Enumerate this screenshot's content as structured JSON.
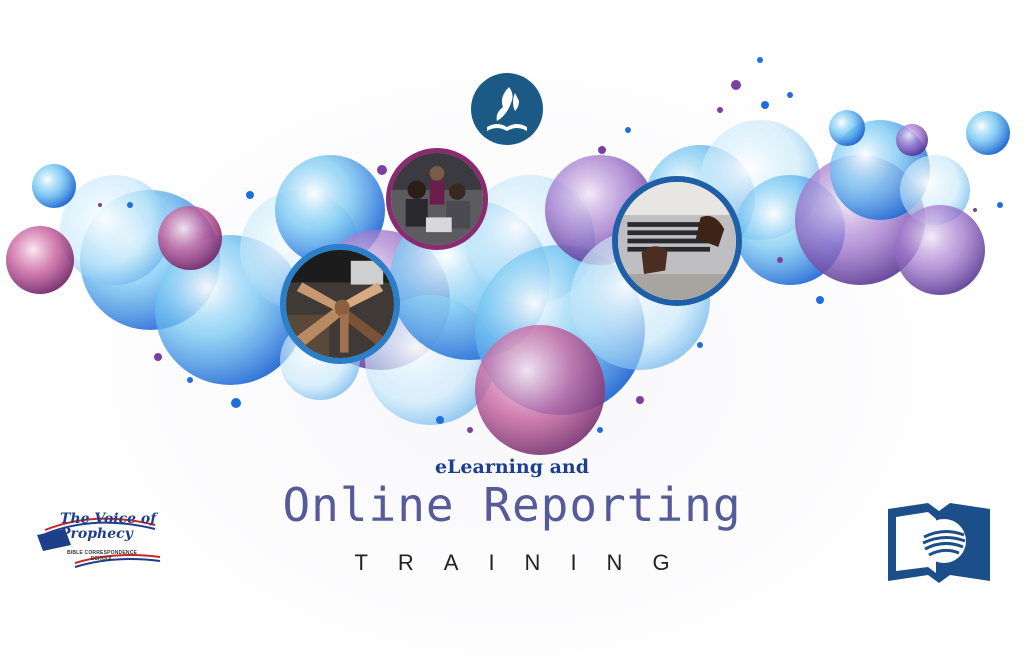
{
  "headline": {
    "line1": "eLearning and",
    "line2": "Online Reporting",
    "line3": "TRAINING"
  },
  "logos": {
    "top": {
      "icon": "adventist-flame-bible-icon",
      "color": "#1c5a86"
    },
    "bottom_left": {
      "title": "The Voice of\nProphecy",
      "subtitle": "BIBLE CORRESPONDENCE SCHOOL",
      "icon": "voice-of-prophecy-logo"
    },
    "bottom_right": {
      "icon": "open-book-globe-icon",
      "color": "#1c4f8a"
    }
  },
  "photos": [
    {
      "icon": "team-laptop-photo"
    },
    {
      "icon": "hands-together-photo"
    },
    {
      "icon": "laptop-typing-photo"
    }
  ],
  "colors": {
    "blue": "#1e6fd9",
    "light_blue": "#8fd2f5",
    "purple": "#7a3fa0",
    "magenta": "#b23a7c",
    "headline_blue": "#1d3f8f",
    "headline_violet": "#555a99"
  }
}
